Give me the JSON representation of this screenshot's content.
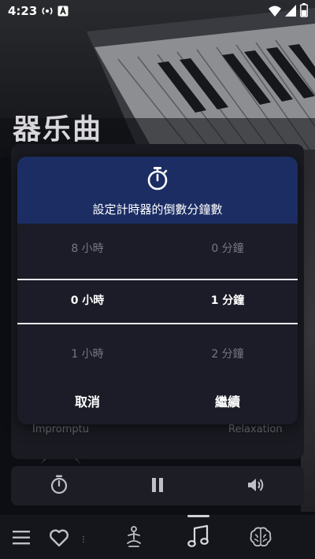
{
  "status_bar": {
    "time": "4:23",
    "icons": [
      "podcast-icon",
      "app-a-icon",
      "wifi-icon",
      "signal-icon",
      "battery-icon"
    ]
  },
  "category": {
    "title": "器乐曲"
  },
  "card": {
    "left_tag": "Impromptu",
    "right_tag": "Relaxation"
  },
  "timer_dialog": {
    "icon": "stopwatch-icon",
    "title": "設定計時器的倒數分鐘數",
    "hours_above": "8 小時",
    "minutes_above": "0 分鐘",
    "hours_selected": "0 小時",
    "minutes_selected": "1 分鐘",
    "hours_below": "1 小時",
    "minutes_below": "2 分鐘",
    "cancel_label": "取消",
    "continue_label": "繼續"
  },
  "player": {
    "icons": [
      "stopwatch-icon",
      "pause-icon",
      "volume-icon"
    ]
  },
  "bottom_nav": {
    "icons": [
      "menu-icon",
      "heart-icon",
      "meditation-icon",
      "music-note-icon",
      "brain-icon"
    ],
    "active_index": 3
  },
  "colors": {
    "dialog_header": "#1b2d63",
    "dialog_body": "#1c1c28",
    "separator": "#e8e8ec",
    "dim_text": "#777883"
  }
}
